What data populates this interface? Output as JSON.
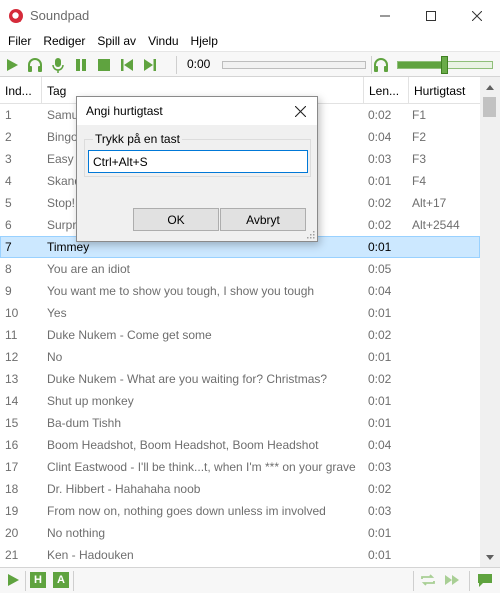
{
  "window": {
    "title": "Soundpad",
    "icon": "soundpad-logo-icon",
    "brand_color": "#d52b3a",
    "controls": [
      "minimize-icon",
      "maximize-icon",
      "close-icon"
    ]
  },
  "menu": [
    "Filer",
    "Rediger",
    "Spill av",
    "Vindu",
    "Hjelp"
  ],
  "toolbar": {
    "accent": "#5fa33f",
    "time": "0:00",
    "volume_fraction": 0.5,
    "icons": [
      "play-icon",
      "headphones-icon",
      "microphone-icon",
      "pause-icon",
      "stop-icon",
      "previous-icon",
      "next-icon",
      "headphones-volume-icon"
    ]
  },
  "table": {
    "columns": [
      "Ind...",
      "Tag",
      "Len...",
      "Hurtigtast"
    ],
    "selected_index": 6,
    "rows": [
      {
        "idx": "1",
        "tag": "Samu",
        "len": "0:02",
        "hotkey": "F1"
      },
      {
        "idx": "2",
        "tag": "Bingo",
        "len": "0:04",
        "hotkey": "F2"
      },
      {
        "idx": "3",
        "tag": "Easy p",
        "len": "0:03",
        "hotkey": "F3"
      },
      {
        "idx": "4",
        "tag": "Skand",
        "len": "0:01",
        "hotkey": "F4"
      },
      {
        "idx": "5",
        "tag": "Stop!",
        "len": "0:02",
        "hotkey": "Alt+17"
      },
      {
        "idx": "6",
        "tag": "Surpr",
        "len": "0:02",
        "hotkey": "Alt+2544"
      },
      {
        "idx": "7",
        "tag": "Timmey",
        "len": "0:01",
        "hotkey": ""
      },
      {
        "idx": "8",
        "tag": "You are an idiot",
        "len": "0:05",
        "hotkey": ""
      },
      {
        "idx": "9",
        "tag": "You want me to show you tough, I show you tough",
        "len": "0:04",
        "hotkey": ""
      },
      {
        "idx": "10",
        "tag": "Yes",
        "len": "0:01",
        "hotkey": ""
      },
      {
        "idx": "11",
        "tag": "Duke Nukem - Come get some",
        "len": "0:02",
        "hotkey": ""
      },
      {
        "idx": "12",
        "tag": "No",
        "len": "0:01",
        "hotkey": ""
      },
      {
        "idx": "13",
        "tag": "Duke Nukem - What are you waiting for? Christmas?",
        "len": "0:02",
        "hotkey": ""
      },
      {
        "idx": "14",
        "tag": "Shut up monkey",
        "len": "0:01",
        "hotkey": ""
      },
      {
        "idx": "15",
        "tag": "Ba-dum Tishh",
        "len": "0:01",
        "hotkey": ""
      },
      {
        "idx": "16",
        "tag": "Boom Headshot, Boom Headshot, Boom Headshot",
        "len": "0:04",
        "hotkey": ""
      },
      {
        "idx": "17",
        "tag": "Clint Eastwood - I'll be think...t, when I'm *** on your grave",
        "len": "0:03",
        "hotkey": ""
      },
      {
        "idx": "18",
        "tag": "Dr. Hibbert - Hahahaha noob",
        "len": "0:02",
        "hotkey": ""
      },
      {
        "idx": "19",
        "tag": "From now on, nothing goes down unless im involved",
        "len": "0:03",
        "hotkey": ""
      },
      {
        "idx": "20",
        "tag": "No nothing",
        "len": "0:01",
        "hotkey": ""
      },
      {
        "idx": "21",
        "tag": "Ken - Hadouken",
        "len": "0:01",
        "hotkey": ""
      }
    ]
  },
  "statusbar": {
    "h_label": "H",
    "a_label": "A",
    "icons": [
      "play-icon",
      "repeat-icon",
      "fast-forward-icon",
      "chat-icon"
    ]
  },
  "dialog": {
    "title": "Angi hurtigtast",
    "group_label": "Trykk på en tast",
    "input_value": "Ctrl+Alt+S",
    "ok_label": "OK",
    "cancel_label": "Avbryt"
  }
}
